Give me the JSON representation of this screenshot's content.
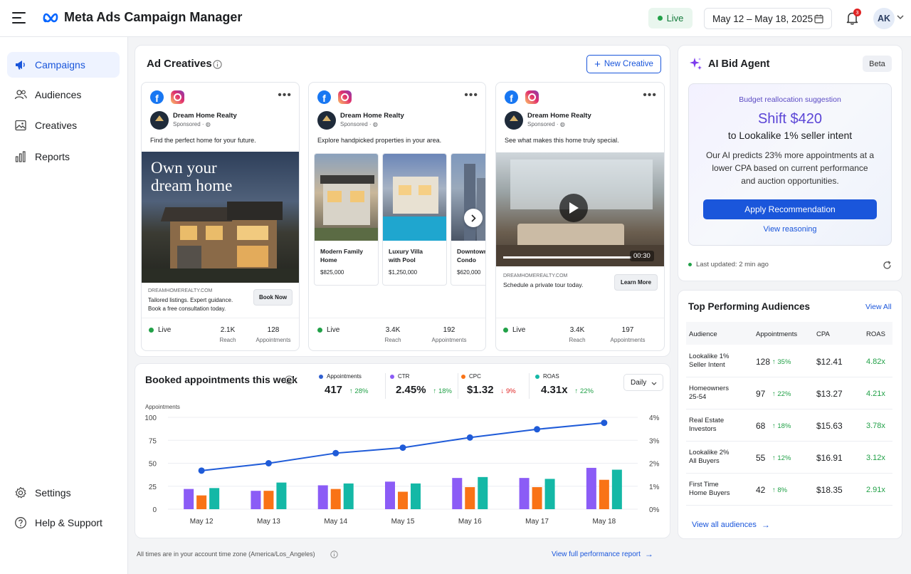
{
  "app": {
    "title": "Meta Ads Campaign Manager",
    "status": "Live",
    "date_range": "May 12 – May 18, 2025",
    "notif_count": "3",
    "user_initials": "AK"
  },
  "sidebar": {
    "items": [
      {
        "label": "Campaigns",
        "icon": "megaphone-icon",
        "active": true
      },
      {
        "label": "Audiences",
        "icon": "users-icon"
      },
      {
        "label": "Creatives",
        "icon": "image-icon"
      },
      {
        "label": "Reports",
        "icon": "bar-chart-icon"
      }
    ],
    "bottom": [
      {
        "label": "Settings",
        "icon": "gear-icon"
      },
      {
        "label": "Help & Support",
        "icon": "help-icon"
      }
    ]
  },
  "creatives": {
    "title": "Ad Creatives",
    "new_button": "New Creative",
    "ads": [
      {
        "page": "Dream Home Realty",
        "sponsored": "Sponsored ·",
        "caption": "Find the perfect home for your future.",
        "overlay": [
          "Own your",
          "dream home"
        ],
        "domain": "DREAMHOMEREALTY.COM",
        "desc": [
          "Tailored listings. Expert guidance.",
          "Book a free consultation today."
        ],
        "cta": "Book Now",
        "status": "Live",
        "reach": "2.1K",
        "reach_label": "Reach",
        "appts": "128",
        "appts_label": "Appointments"
      },
      {
        "page": "Dream Home Realty",
        "sponsored": "Sponsored ·",
        "caption": "Explore handpicked properties in your area.",
        "cards": [
          {
            "name": [
              "Modern Family",
              "Home"
            ],
            "price": "$825,000"
          },
          {
            "name": [
              "Luxury Villa",
              "with Pool"
            ],
            "price": "$1,250,000"
          },
          {
            "name": [
              "Downtown",
              "Condo"
            ],
            "price": "$620,000"
          }
        ],
        "status": "Live",
        "reach": "3.4K",
        "reach_label": "Reach",
        "appts": "192",
        "appts_label": "Appointments"
      },
      {
        "page": "Dream Home Realty",
        "sponsored": "Sponsored ·",
        "caption": "See what makes this home truly special.",
        "duration": "00:30",
        "domain": "DREAMHOMEREALTY.COM",
        "desc": [
          "Schedule a private tour today."
        ],
        "cta": "Learn More",
        "status": "Live",
        "reach": "3.4K",
        "reach_label": "Reach",
        "appts": "197",
        "appts_label": "Appointments"
      }
    ]
  },
  "booked": {
    "title": "Booked appointments this week",
    "interval": "Daily",
    "kpis": [
      {
        "label": "Appointments",
        "value": "417",
        "delta": "28%",
        "dir": "up",
        "color": "#2f5fd0"
      },
      {
        "label": "CTR",
        "value": "2.45%",
        "delta": "18%",
        "dir": "up",
        "color": "#8b5cf6"
      },
      {
        "label": "CPC",
        "value": "$1.32",
        "delta": "9%",
        "dir": "down",
        "color": "#f97316"
      },
      {
        "label": "ROAS",
        "value": "4.31x",
        "delta": "22%",
        "dir": "up",
        "color": "#14b8a6"
      }
    ]
  },
  "chart_data": {
    "type": "bar",
    "ylabel": "Appointments",
    "categories": [
      "May 12",
      "May 13",
      "May 14",
      "May 15",
      "May 16",
      "May 17",
      "May 18"
    ],
    "ylim": [
      0,
      100
    ],
    "yticks": [
      "100",
      "75",
      "50",
      "25",
      "0"
    ],
    "y2ticks": [
      "4%",
      "3%",
      "2%",
      "1%",
      "0%"
    ],
    "y2lim": [
      0,
      4
    ],
    "series": [
      {
        "values": [
          22,
          20,
          26,
          30,
          34,
          34,
          45
        ],
        "type": "bar",
        "color": "#8b5cf6"
      },
      {
        "values": [
          15,
          20,
          22,
          19,
          24,
          24,
          32
        ],
        "type": "bar",
        "color": "#f97316"
      },
      {
        "values": [
          23,
          29,
          28,
          28,
          35,
          33,
          43
        ],
        "type": "bar",
        "color": "#14b8a6"
      },
      {
        "values": [
          42,
          50,
          61,
          67,
          78,
          87,
          94
        ],
        "type": "line",
        "color": "#1f5bd8"
      }
    ]
  },
  "footer": {
    "note": "All times are in your account time zone (America/Los_Angeles)",
    "report_link": "View full performance report"
  },
  "agent": {
    "title": "AI Bid Agent",
    "badge": "Beta",
    "suggest_label": "Budget reallocation suggestion",
    "headline": "Shift $420",
    "target": "to Lookalike 1% seller intent",
    "body": [
      "Our AI predicts 23% more appointments at a",
      "lower CPA based on current performance",
      "and auction opportunities."
    ],
    "apply": "Apply Recommendation",
    "reasoning": "View reasoning",
    "updated": "Last updated: 2 min ago"
  },
  "audiences": {
    "title": "Top Performing Audiences",
    "view_all": "View All",
    "columns": [
      "Audience",
      "Appointments",
      "CPA",
      "ROAS"
    ],
    "rows": [
      {
        "name": [
          "Lookalike 1%",
          "Seller Intent"
        ],
        "appts": "128",
        "delta": "35%",
        "cpa": "$12.41",
        "roas": "4.82x"
      },
      {
        "name": [
          "Homeowners",
          "25-54"
        ],
        "appts": "97",
        "delta": "22%",
        "cpa": "$13.27",
        "roas": "4.21x"
      },
      {
        "name": [
          "Real Estate",
          "Investors"
        ],
        "appts": "68",
        "delta": "18%",
        "cpa": "$15.63",
        "roas": "3.78x"
      },
      {
        "name": [
          "Lookalike 2%",
          "All Buyers"
        ],
        "appts": "55",
        "delta": "12%",
        "cpa": "$16.91",
        "roas": "3.12x"
      },
      {
        "name": [
          "First Time",
          "Home Buyers"
        ],
        "appts": "42",
        "delta": "8%",
        "cpa": "$18.35",
        "roas": "2.91x"
      }
    ],
    "footer_link": "View all audiences"
  }
}
